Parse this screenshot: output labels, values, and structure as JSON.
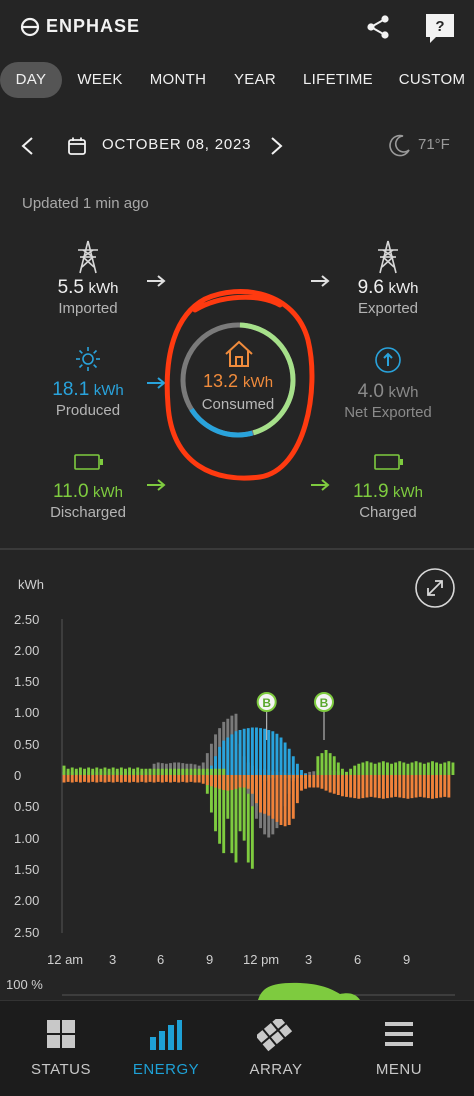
{
  "header": {
    "brand": "ENPHASE",
    "share_icon": "share-icon",
    "help_icon": "help-question-icon"
  },
  "tabs": [
    {
      "label": "DAY",
      "active": true
    },
    {
      "label": "WEEK",
      "active": false
    },
    {
      "label": "MONTH",
      "active": false
    },
    {
      "label": "YEAR",
      "active": false
    },
    {
      "label": "LIFETIME",
      "active": false
    },
    {
      "label": "CUSTOM",
      "active": false
    }
  ],
  "date_bar": {
    "date": "OCTOBER 08, 2023",
    "temperature": "71°F"
  },
  "updated": "Updated 1 min ago",
  "energy": {
    "imported": {
      "value": "5.5",
      "unit": "kWh",
      "label": "Imported"
    },
    "exported": {
      "value": "9.6",
      "unit": "kWh",
      "label": "Exported"
    },
    "produced": {
      "value": "18.1",
      "unit": "kWh",
      "label": "Produced"
    },
    "consumed": {
      "value": "13.2",
      "unit": "kWh",
      "label": "Consumed"
    },
    "net_exported": {
      "value": "4.0",
      "unit": "kWh",
      "label": "Net Exported"
    },
    "discharged": {
      "value": "11.0",
      "unit": "kWh",
      "label": "Discharged"
    },
    "charged": {
      "value": "11.9",
      "unit": "kWh",
      "label": "Charged"
    }
  },
  "colors": {
    "solar": "#29a3dc",
    "battery": "#7ecb3f",
    "grid": "#7a7a7a",
    "consumption": "#f0823a",
    "annotation": "#ff3a10",
    "ring_light_green": "#a6e08a"
  },
  "chart_data": {
    "type": "bar",
    "ylabel": "kWh",
    "y_ticks_up": [
      "2.50",
      "2.00",
      "1.50",
      "1.00",
      "0.50",
      "0"
    ],
    "y_ticks_down": [
      "0.50",
      "1.00",
      "1.50",
      "2.00",
      "2.50"
    ],
    "ylim": [
      -2.5,
      2.5
    ],
    "x_ticks": [
      "12 am",
      "3",
      "6",
      "9",
      "12 pm",
      "3",
      "6",
      "9"
    ],
    "markers": [
      {
        "label": "B",
        "hour": 12.5
      },
      {
        "label": "B",
        "hour": 16.0
      }
    ],
    "series": [
      {
        "name": "Produced",
        "color": "#29a3dc",
        "values": [
          0,
          0,
          0,
          0,
          0,
          0,
          0,
          0,
          0,
          0,
          0,
          0,
          0,
          0,
          0,
          0,
          0,
          0,
          0,
          0,
          0,
          0,
          0,
          0,
          0,
          0,
          0,
          0,
          0,
          0,
          0,
          0,
          0,
          0,
          0,
          0.05,
          0.15,
          0.3,
          0.45,
          0.55,
          0.6,
          0.65,
          0.7,
          0.72,
          0.74,
          0.75,
          0.76,
          0.76,
          0.75,
          0.74,
          0.72,
          0.7,
          0.66,
          0.6,
          0.52,
          0.42,
          0.3,
          0.18,
          0.08,
          0.02,
          0,
          0,
          0,
          0,
          0,
          0,
          0,
          0,
          0,
          0,
          0,
          0,
          0,
          0,
          0,
          0,
          0,
          0,
          0,
          0,
          0,
          0,
          0,
          0,
          0,
          0,
          0,
          0,
          0,
          0,
          0,
          0,
          0,
          0,
          0,
          0
        ]
      },
      {
        "name": "Imported",
        "color": "#7a7a7a",
        "values": [
          0.05,
          0.06,
          0.05,
          0.06,
          0.05,
          0.06,
          0.05,
          0.06,
          0.05,
          0.06,
          0.05,
          0.06,
          0.05,
          0.06,
          0.05,
          0.06,
          0.05,
          0.06,
          0.05,
          0.06,
          0.05,
          0.1,
          0.18,
          0.2,
          0.19,
          0.18,
          0.19,
          0.2,
          0.2,
          0.19,
          0.18,
          0.18,
          0.17,
          0.15,
          0.2,
          0.35,
          0.5,
          0.65,
          0.75,
          0.85,
          0.9,
          0.95,
          0.98,
          0.5,
          0.3,
          0.2,
          0.15,
          0.1,
          0.1,
          0.1,
          0.08,
          0.06,
          0.05,
          0.05,
          0.04,
          0.03,
          0.02,
          0.02,
          0.02,
          0.03,
          0.05,
          0.06,
          0.07,
          0.08,
          0.08,
          0.08,
          0.07,
          0.06,
          0.06,
          0.05,
          0,
          0,
          0,
          0,
          0,
          0,
          0,
          0,
          0,
          0,
          0,
          0,
          0,
          0,
          0,
          0,
          0,
          0,
          0,
          0,
          0,
          0,
          0,
          0,
          0,
          0
        ]
      },
      {
        "name": "Charged",
        "color": "#7ecb3f",
        "values": [
          0.15,
          0.1,
          0.12,
          0.1,
          0.12,
          0.1,
          0.12,
          0.1,
          0.12,
          0.1,
          0.12,
          0.1,
          0.12,
          0.1,
          0.12,
          0.1,
          0.12,
          0.1,
          0.12,
          0.1,
          0.1,
          0.1,
          0.1,
          0.1,
          0.1,
          0.1,
          0.1,
          0.1,
          0.1,
          0.1,
          0.1,
          0.1,
          0.1,
          0.1,
          0.1,
          0.1,
          0.1,
          0.1,
          0.1,
          0.1,
          0,
          0,
          0,
          0,
          0,
          0,
          0,
          0,
          0,
          0,
          0,
          0,
          0,
          0,
          0,
          0,
          0,
          0,
          0,
          0,
          0,
          0,
          0.3,
          0.35,
          0.4,
          0.35,
          0.3,
          0.2,
          0.1,
          0.05,
          0.1,
          0.15,
          0.18,
          0.2,
          0.22,
          0.2,
          0.18,
          0.2,
          0.22,
          0.2,
          0.18,
          0.2,
          0.22,
          0.2,
          0.18,
          0.2,
          0.22,
          0.2,
          0.18,
          0.2,
          0.22,
          0.2,
          0.18,
          0.2,
          0.22,
          0.2
        ]
      },
      {
        "name": "Discharged",
        "color": "#7ecb3f",
        "values": [
          0,
          0,
          0,
          0,
          0,
          0,
          0,
          0,
          0,
          0,
          0,
          0,
          0,
          0,
          0,
          0,
          0,
          0,
          0,
          0,
          0,
          0,
          0,
          0,
          0,
          0,
          0,
          0,
          0,
          0,
          0,
          0,
          0,
          0,
          0,
          0.3,
          0.6,
          0.9,
          1.1,
          1.25,
          0.7,
          1.25,
          1.4,
          0.9,
          1.05,
          1.4,
          1.5,
          0.5,
          0.2,
          0.1,
          0.05,
          0.05,
          0.05,
          0.05,
          0.05,
          0.05,
          0.05,
          0.05,
          0.05,
          0.05,
          0,
          0,
          0,
          0,
          0,
          0,
          0,
          0,
          0,
          0,
          0,
          0,
          0,
          0,
          0,
          0,
          0,
          0,
          0,
          0,
          0,
          0,
          0,
          0,
          0,
          0,
          0,
          0,
          0,
          0,
          0,
          0,
          0,
          0,
          0,
          0
        ]
      },
      {
        "name": "Exported",
        "color": "#7a7a7a",
        "values": [
          0,
          0,
          0,
          0,
          0,
          0,
          0,
          0,
          0,
          0,
          0,
          0,
          0,
          0,
          0,
          0,
          0,
          0,
          0,
          0,
          0,
          0,
          0,
          0,
          0,
          0,
          0,
          0,
          0,
          0,
          0,
          0,
          0,
          0,
          0,
          0,
          0,
          0,
          0,
          0,
          0,
          0,
          0,
          0,
          0.1,
          0.3,
          0.5,
          0.7,
          0.85,
          0.95,
          1.0,
          0.95,
          0.85,
          0.7,
          0.5,
          0.3,
          0.1,
          0,
          0,
          0,
          0,
          0,
          0,
          0,
          0,
          0,
          0,
          0,
          0,
          0,
          0,
          0,
          0,
          0,
          0,
          0,
          0,
          0,
          0,
          0,
          0,
          0,
          0,
          0,
          0,
          0,
          0,
          0,
          0,
          0,
          0,
          0,
          0,
          0,
          0,
          0
        ]
      },
      {
        "name": "Consumed",
        "color": "#f0823a",
        "values": [
          0.12,
          0.11,
          0.12,
          0.11,
          0.12,
          0.11,
          0.12,
          0.11,
          0.12,
          0.11,
          0.12,
          0.11,
          0.12,
          0.11,
          0.12,
          0.11,
          0.12,
          0.11,
          0.12,
          0.11,
          0.12,
          0.11,
          0.12,
          0.11,
          0.12,
          0.11,
          0.12,
          0.11,
          0.12,
          0.11,
          0.12,
          0.11,
          0.12,
          0.12,
          0.14,
          0.16,
          0.18,
          0.2,
          0.22,
          0.24,
          0.25,
          0.24,
          0.22,
          0.2,
          0.2,
          0.22,
          0.3,
          0.45,
          0.6,
          0.62,
          0.65,
          0.7,
          0.75,
          0.8,
          0.82,
          0.8,
          0.7,
          0.45,
          0.25,
          0.22,
          0.2,
          0.2,
          0.2,
          0.22,
          0.25,
          0.28,
          0.3,
          0.32,
          0.34,
          0.35,
          0.36,
          0.37,
          0.38,
          0.37,
          0.36,
          0.35,
          0.36,
          0.37,
          0.38,
          0.37,
          0.36,
          0.35,
          0.36,
          0.37,
          0.38,
          0.37,
          0.36,
          0.35,
          0.36,
          0.37,
          0.38,
          0.37,
          0.36,
          0.35,
          0.36
        ]
      }
    ]
  },
  "battery_pct_label": "100 %",
  "bottom_nav": [
    {
      "label": "STATUS",
      "active": false,
      "icon": "status-grid-icon"
    },
    {
      "label": "ENERGY",
      "active": true,
      "icon": "energy-bars-icon"
    },
    {
      "label": "ARRAY",
      "active": false,
      "icon": "solar-array-icon"
    },
    {
      "label": "MENU",
      "active": false,
      "icon": "menu-hamburger-icon"
    }
  ]
}
